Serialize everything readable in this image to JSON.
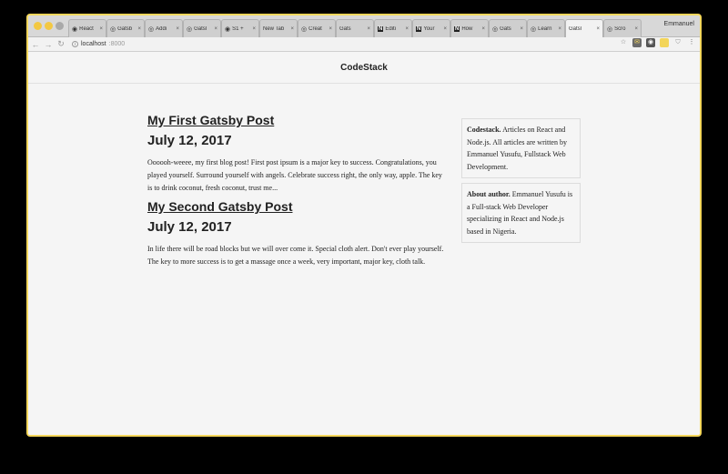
{
  "browser": {
    "profile_name": "Emmanuel",
    "tabs": [
      {
        "title": "React",
        "icon": "github-icon"
      },
      {
        "title": "Gatsb",
        "icon": "globe-icon"
      },
      {
        "title": "Addi",
        "icon": "globe-icon"
      },
      {
        "title": "Gatsl",
        "icon": "globe-icon"
      },
      {
        "title": "S1 +",
        "icon": "github-icon"
      },
      {
        "title": "New Tab",
        "icon": ""
      },
      {
        "title": "Creat",
        "icon": "globe-icon"
      },
      {
        "title": "Gats",
        "icon": ""
      },
      {
        "title": "Editi",
        "icon": "notion-icon"
      },
      {
        "title": "Your",
        "icon": "notion-icon"
      },
      {
        "title": "How",
        "icon": "notion-icon"
      },
      {
        "title": "Gats",
        "icon": "globe-icon"
      },
      {
        "title": "Learn",
        "icon": "globe-icon"
      },
      {
        "title": "Gatsl",
        "icon": "",
        "active": true
      },
      {
        "title": "Scro",
        "icon": "globe-icon"
      }
    ],
    "url": {
      "host": "localhost",
      "rest": ":8000"
    },
    "accent_color": "#f5d75c"
  },
  "site": {
    "title": "CodeStack",
    "posts": [
      {
        "title": "My First Gatsby Post",
        "date": "July 12, 2017",
        "excerpt": "Oooooh-weeee, my first blog post! First post ipsum is a major key to success. Congratulations, you played yourself. Surround yourself with angels. Celebrate success right, the only way, apple. The key is to drink coconut, fresh coconut, trust me..."
      },
      {
        "title": "My Second Gatsby Post",
        "date": "July 12, 2017",
        "excerpt": "In life there will be road blocks but we will over come it. Special cloth alert. Don't ever play yourself. The key to more success is to get a massage once a week, very important, major key, cloth talk."
      }
    ],
    "sidebar": [
      {
        "heading": "Codestack.",
        "text": "Articles on React and Node.js. All articles are written by Emmanuel Yusufu, Fullstack Web Development."
      },
      {
        "heading": "About author.",
        "text": "Emmanuel Yusufu is a Full-stack Web Developer specializing in React and Node.js based in Nigeria."
      }
    ]
  }
}
